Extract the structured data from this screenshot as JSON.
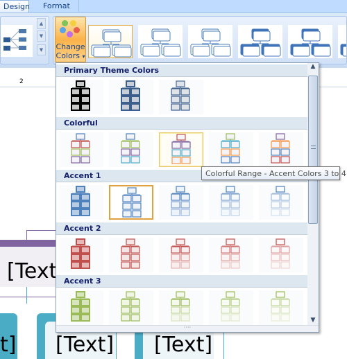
{
  "tabs": [
    {
      "label": "Design",
      "active": true
    },
    {
      "label": "Format",
      "active": false
    }
  ],
  "ribbon": {
    "change_colors_line1": "Change",
    "change_colors_line2": "Colors",
    "dropdown_arrow": "▾",
    "style_thumbs": 6,
    "selected_style": 0
  },
  "ruler": {
    "mark": "2"
  },
  "document": {
    "placeholders": [
      "[Text",
      "t]",
      "[Text]",
      "[Text]"
    ],
    "accent_purple": "#8064a2",
    "accent_teal": "#4bacc6"
  },
  "gallery": {
    "sections": [
      {
        "title": "Primary Theme Colors",
        "items": [
          {
            "c": [
              "#000",
              "#000",
              "#000",
              "#000"
            ],
            "fill": "#c8c8c8",
            "bold": true
          },
          {
            "c": [
              "#3b5e8c",
              "#3b5e8c",
              "#3b5e8c",
              "#3b5e8c"
            ],
            "fill": "#c9cfd8",
            "bold": true
          },
          {
            "c": [
              "#4a6b9a",
              "#3b5e8c",
              "#3b5e8c",
              "#3b5e8c"
            ],
            "fill": "#dfe3e8"
          }
        ]
      },
      {
        "title": "Colorful",
        "items": [
          {
            "c": [
              "#4f81bd",
              "#c0504d",
              "#9bbb59",
              "#8064a2"
            ],
            "fill": "#f4f4f8"
          },
          {
            "c": [
              "#4f81bd",
              "#9bbb59",
              "#8064a2",
              "#4bacc6"
            ],
            "fill": "#f4f4f8"
          },
          {
            "c": [
              "#c0504d",
              "#8064a2",
              "#4bacc6",
              "#f79646"
            ],
            "fill": "#f4f4f8",
            "state": "hover"
          },
          {
            "c": [
              "#9bbb59",
              "#4bacc6",
              "#f79646",
              "#4f81bd"
            ],
            "fill": "#f4f4f8"
          },
          {
            "c": [
              "#8064a2",
              "#f79646",
              "#4f81bd",
              "#c0504d"
            ],
            "fill": "#f4f4f8"
          }
        ]
      },
      {
        "title": "Accent 1",
        "items": [
          {
            "c": [
              "#4f81bd",
              "#4f81bd",
              "#4f81bd",
              "#4f81bd"
            ],
            "fill": "#b8cce4",
            "bold": true
          },
          {
            "c": [
              "#4f81bd",
              "#4f81bd",
              "#4f81bd",
              "#4f81bd"
            ],
            "fill": "#eef3f9",
            "state": "selected"
          },
          {
            "c": [
              "#4f81bd",
              "#4f81bd",
              "#7fa3d0",
              "#9fbadd"
            ],
            "fill": "#eef3f9"
          },
          {
            "c": [
              "#4f81bd",
              "#7fa3d0",
              "#a7c0df",
              "#c3d4ea"
            ],
            "fill": "#f5f8fb"
          },
          {
            "c": [
              "#4f81bd",
              "#9fbadd",
              "#b9cce6",
              "#d3e0f0"
            ],
            "fill": "#fafbfd"
          }
        ]
      },
      {
        "title": "Accent 2",
        "items": [
          {
            "c": [
              "#c0504d",
              "#c0504d",
              "#c0504d",
              "#c0504d"
            ],
            "fill": "#e6b9b8",
            "bold": true
          },
          {
            "c": [
              "#c0504d",
              "#c0504d",
              "#c0504d",
              "#c0504d"
            ],
            "fill": "#f5e6e6"
          },
          {
            "c": [
              "#c0504d",
              "#c0504d",
              "#d99594",
              "#e3b3b2"
            ],
            "fill": "#f8eeee"
          },
          {
            "c": [
              "#c0504d",
              "#d07674",
              "#e0a5a4",
              "#ecc8c7"
            ],
            "fill": "#faf3f3"
          },
          {
            "c": [
              "#c0504d",
              "#dea09f",
              "#e8bebd",
              "#f0d4d3"
            ],
            "fill": "#fcf8f8"
          }
        ]
      },
      {
        "title": "Accent 3",
        "items": [
          {
            "c": [
              "#9bbb59",
              "#9bbb59",
              "#9bbb59",
              "#9bbb59"
            ],
            "fill": "#d7e4bd",
            "bold": true
          },
          {
            "c": [
              "#9bbb59",
              "#9bbb59",
              "#9bbb59",
              "#9bbb59"
            ],
            "fill": "#f0f5e6"
          },
          {
            "c": [
              "#9bbb59",
              "#9bbb59",
              "#c3d69b",
              "#d7e4bd"
            ],
            "fill": "#f5f8ee"
          },
          {
            "c": [
              "#9bbb59",
              "#b3cc83",
              "#cfdfb0",
              "#e1ebcf"
            ],
            "fill": "#f8fbf3"
          },
          {
            "c": [
              "#9bbb59",
              "#c3d69b",
              "#d7e4bd",
              "#e6eed6"
            ],
            "fill": "#fbfcf8"
          }
        ]
      }
    ],
    "scroll_up": "▲",
    "scroll_down": "▼",
    "resize_grip": "····"
  },
  "tooltip": "Colorful Range - Accent Colors 3 to 4"
}
